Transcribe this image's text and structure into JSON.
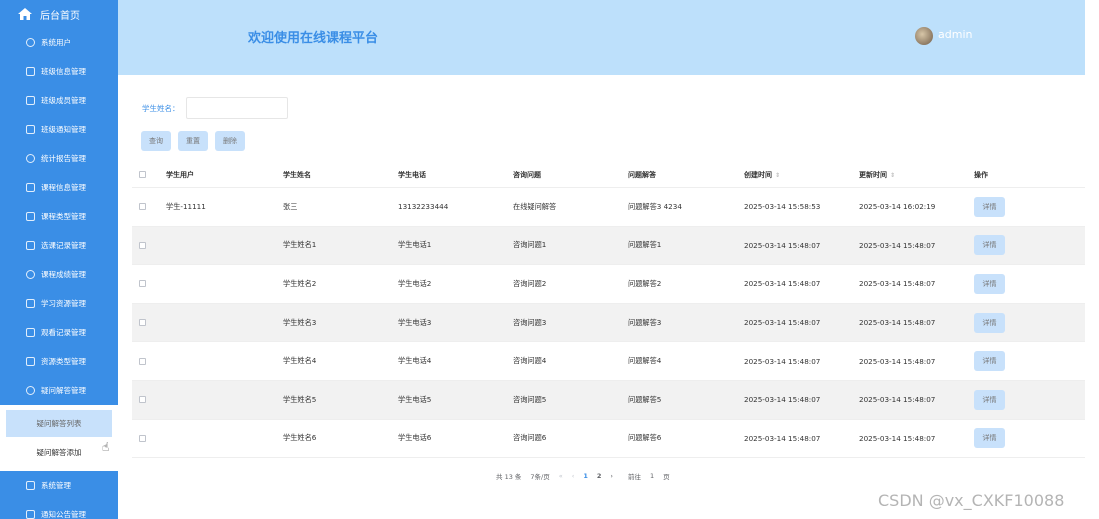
{
  "sidebar": {
    "home_label": "后台首页",
    "items": [
      {
        "label": "系统用户",
        "icon": "round"
      },
      {
        "label": "班级信息管理",
        "icon": "square"
      },
      {
        "label": "班级成员管理",
        "icon": "square"
      },
      {
        "label": "班级通知管理",
        "icon": "square"
      },
      {
        "label": "统计报告管理",
        "icon": "round"
      },
      {
        "label": "课程信息管理",
        "icon": "square"
      },
      {
        "label": "课程类型管理",
        "icon": "square"
      },
      {
        "label": "选课记录管理",
        "icon": "square"
      },
      {
        "label": "课程成绩管理",
        "icon": "round"
      },
      {
        "label": "学习资源管理",
        "icon": "square"
      },
      {
        "label": "观看记录管理",
        "icon": "square"
      },
      {
        "label": "资源类型管理",
        "icon": "square"
      },
      {
        "label": "疑问解答管理",
        "icon": "round"
      }
    ],
    "submenu": [
      {
        "label": "疑问解答列表",
        "active": true
      },
      {
        "label": "疑问解答添加",
        "active": false
      }
    ],
    "bottom_items": [
      {
        "label": "系统管理",
        "icon": "square"
      },
      {
        "label": "通知公告管理",
        "icon": "square"
      }
    ]
  },
  "header": {
    "title": "欢迎使用在线课程平台",
    "user": "admin"
  },
  "search": {
    "label": "学生姓名：",
    "value": ""
  },
  "actions": {
    "query": "查询",
    "reset": "重置",
    "delete": "删除"
  },
  "table": {
    "columns": [
      "学生用户",
      "学生姓名",
      "学生电话",
      "咨询问题",
      "问题解答",
      "创建时间",
      "更新时间",
      "操作"
    ],
    "sort_icon": "⇕",
    "detail_label": "详情",
    "rows": [
      {
        "user": "学生-11111",
        "name": "张三",
        "phone": "13132233444",
        "question": "在线疑问解答",
        "answer": "问题解答3 4234",
        "created": "2025-03-14 15:58:53",
        "updated": "2025-03-14 16:02:19"
      },
      {
        "user": "",
        "name": "学生姓名1",
        "phone": "学生电话1",
        "question": "咨询问题1",
        "answer": "问题解答1",
        "created": "2025-03-14 15:48:07",
        "updated": "2025-03-14 15:48:07"
      },
      {
        "user": "",
        "name": "学生姓名2",
        "phone": "学生电话2",
        "question": "咨询问题2",
        "answer": "问题解答2",
        "created": "2025-03-14 15:48:07",
        "updated": "2025-03-14 15:48:07"
      },
      {
        "user": "",
        "name": "学生姓名3",
        "phone": "学生电话3",
        "question": "咨询问题3",
        "answer": "问题解答3",
        "created": "2025-03-14 15:48:07",
        "updated": "2025-03-14 15:48:07"
      },
      {
        "user": "",
        "name": "学生姓名4",
        "phone": "学生电话4",
        "question": "咨询问题4",
        "answer": "问题解答4",
        "created": "2025-03-14 15:48:07",
        "updated": "2025-03-14 15:48:07"
      },
      {
        "user": "",
        "name": "学生姓名5",
        "phone": "学生电话5",
        "question": "咨询问题5",
        "answer": "问题解答5",
        "created": "2025-03-14 15:48:07",
        "updated": "2025-03-14 15:48:07"
      },
      {
        "user": "",
        "name": "学生姓名6",
        "phone": "学生电话6",
        "question": "咨询问题6",
        "answer": "问题解答6",
        "created": "2025-03-14 15:48:07",
        "updated": "2025-03-14 15:48:07"
      }
    ]
  },
  "pagination": {
    "total": "共 13 条",
    "page_size": "7条/页",
    "prev": "‹",
    "next": "›",
    "first": "«",
    "pages": [
      "1",
      "2"
    ],
    "current": "1",
    "goto_label": "前往",
    "goto_value": "1",
    "page_suffix": "页"
  },
  "watermark": "CSDN @vx_CXKF10088",
  "colors": {
    "sidebar": "#3a8ee6",
    "header": "#bde0fb",
    "accent": "#3a8ee6",
    "button": "#c8e1fb"
  }
}
